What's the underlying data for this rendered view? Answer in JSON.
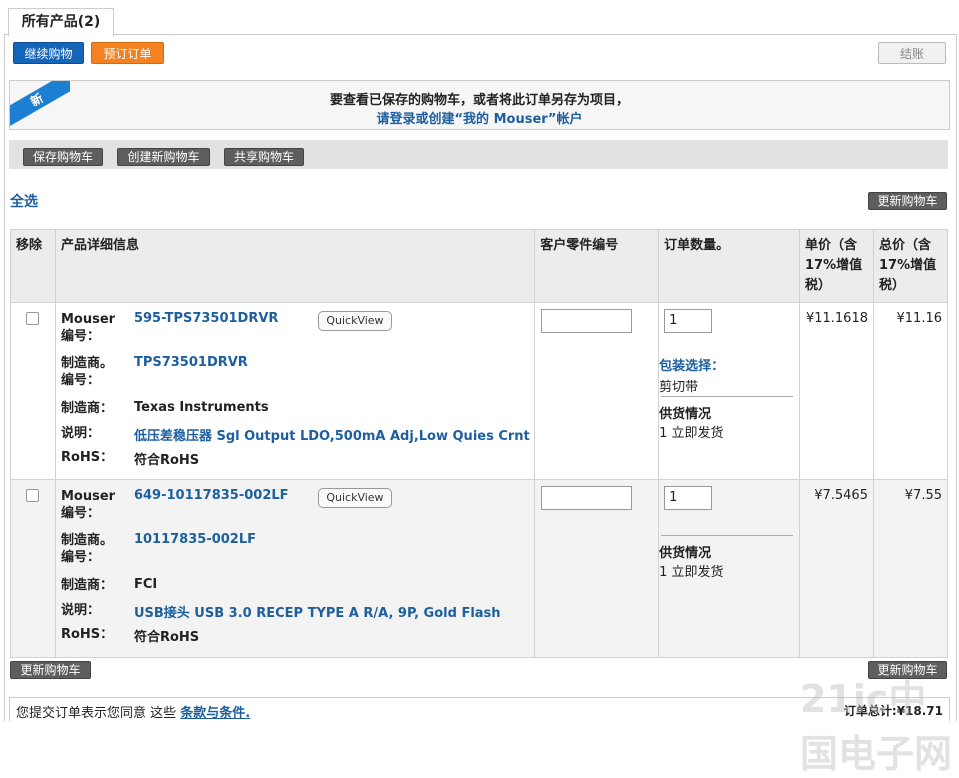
{
  "tab": {
    "label": "所有产品(2)"
  },
  "toolbar": {
    "continue_shopping": "继续购物",
    "preorder": "预订订单",
    "checkout": "结账"
  },
  "banner": {
    "ribbon": "新",
    "line1": "要查看已保存的购物车，或者将此订单另存为项目，",
    "line2": "请登录或创建“我的 Mouser”帐户"
  },
  "cart_actions": {
    "save": "保存购物车",
    "create": "创建新购物车",
    "share": "共享购物车"
  },
  "select_all": "全选",
  "update_cart": "更新购物车",
  "table": {
    "headers": {
      "remove": "移除",
      "details": "产品详细信息",
      "customer_part": "客户零件编号",
      "qty": "订单数量。",
      "unit_price": "单价（含17%增值税）",
      "total_price": "总价（含17%增值税）"
    },
    "labels": {
      "mouser_no_a": "Mouser",
      "mouser_no_b": "编号：",
      "mfr_no_a": "制造商。",
      "mfr_no_b": "编号：",
      "mfr": "制造商：",
      "desc": "说明：",
      "rohs": "RoHS："
    },
    "quickview": "QuickView",
    "rows": [
      {
        "mouser_no": "595-TPS73501DRVR",
        "mfr_no": "TPS73501DRVR",
        "mfr": "Texas Instruments",
        "desc": "低压差稳压器 Sgl Output LDO,500mA Adj,Low Quies Crnt",
        "rohs": "符合RoHS",
        "qty": "1",
        "pkg_label": "包装选择：",
        "pkg_value": "剪切带",
        "stock_label": "供货情况",
        "stock_value": "1 立即发货",
        "unit_price": "¥11.1618",
        "total_price": "¥11.16"
      },
      {
        "mouser_no": "649-10117835-002LF",
        "mfr_no": "10117835-002LF",
        "mfr": "FCI",
        "desc": "USB接头 USB 3.0 RECEP TYPE A R/A, 9P, Gold Flash",
        "rohs": "符合RoHS",
        "qty": "1",
        "stock_label": "供货情况",
        "stock_value": "1 立即发货",
        "unit_price": "¥7.5465",
        "total_price": "¥7.55"
      }
    ]
  },
  "footer": {
    "agree_text": "您提交订单表示您同意 这些",
    "terms_link": "条款与条件.",
    "total_label": "订单总计:",
    "total_value": "¥18.71"
  },
  "watermark": "21ic中国电子网"
}
